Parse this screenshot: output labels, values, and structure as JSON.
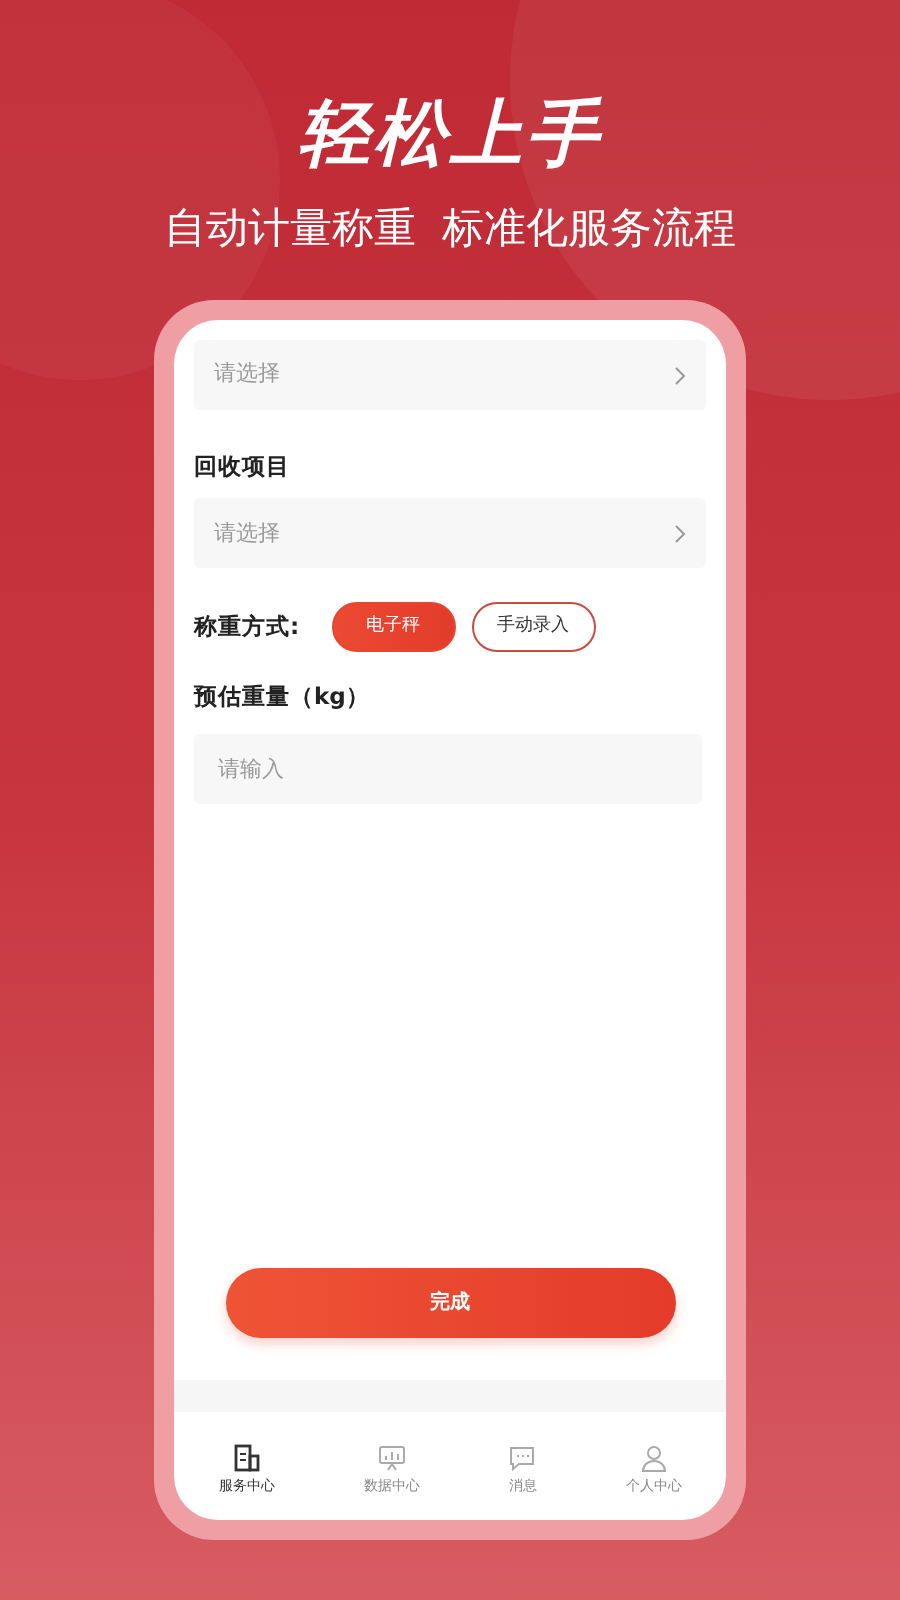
{
  "headline": "轻松上手",
  "subtitle": "自动计量称重  标准化服务流程",
  "form": {
    "first_select": {
      "placeholder": "请选择"
    },
    "item_label": "回收项目",
    "item_select": {
      "placeholder": "请选择"
    },
    "method_label": "称重方式:",
    "methods": [
      {
        "label": "电子秤",
        "selected": true
      },
      {
        "label": "手动录入",
        "selected": false
      }
    ],
    "weight_label": "预估重量（kg）",
    "weight_input": {
      "placeholder": "请输入"
    },
    "submit": "完成"
  },
  "tab_bar": [
    {
      "label": "服务中心",
      "kind": "service",
      "selected": true
    },
    {
      "label": "数据中心",
      "kind": "data",
      "selected": false
    },
    {
      "label": "消息",
      "kind": "message",
      "selected": false
    },
    {
      "label": "个人中心",
      "kind": "profile",
      "selected": false
    }
  ]
}
